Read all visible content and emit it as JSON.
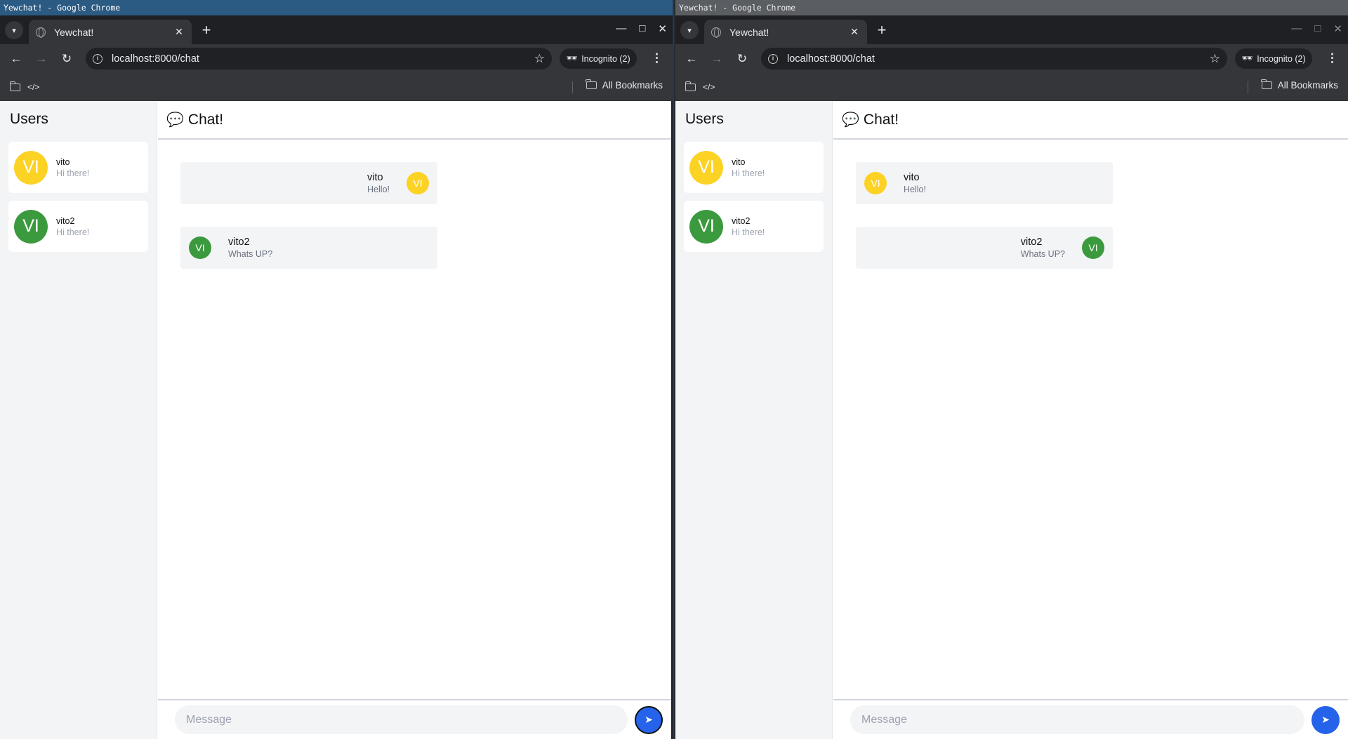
{
  "colors": {
    "yellow_avatar": "#fcd224",
    "green_avatar": "#3b9a3e",
    "send": "#2563eb"
  },
  "windows": [
    {
      "title": "Yewchat! - Google Chrome",
      "tab": {
        "title": "Yewchat!",
        "close": "✕"
      },
      "new_tab": "+",
      "url": "localhost:8000/chat",
      "incognito": "Incognito (2)",
      "bookmark_code": "</>",
      "all_bookmarks": "All Bookmarks",
      "app": {
        "sidebar_title": "Users",
        "users": [
          {
            "initials": "VI",
            "name": "vito",
            "last": "Hi there!",
            "color": "yellow"
          },
          {
            "initials": "VI",
            "name": "vito2",
            "last": "Hi there!",
            "color": "green"
          }
        ],
        "header": {
          "icon": "💬",
          "title": "Chat!"
        },
        "messages": [
          {
            "side": "right",
            "initials": "VI",
            "name": "vito",
            "text": "Hello!",
            "color": "yellow"
          },
          {
            "side": "left",
            "initials": "VI",
            "name": "vito2",
            "text": "Whats UP?",
            "color": "green"
          }
        ],
        "composer_placeholder": "Message"
      }
    },
    {
      "title": "Yewchat! - Google Chrome",
      "tab": {
        "title": "Yewchat!",
        "close": "✕"
      },
      "new_tab": "+",
      "url": "localhost:8000/chat",
      "incognito": "Incognito (2)",
      "bookmark_code": "</>",
      "all_bookmarks": "All Bookmarks",
      "app": {
        "sidebar_title": "Users",
        "users": [
          {
            "initials": "VI",
            "name": "vito",
            "last": "Hi there!",
            "color": "yellow"
          },
          {
            "initials": "VI",
            "name": "vito2",
            "last": "Hi there!",
            "color": "green"
          }
        ],
        "header": {
          "icon": "💬",
          "title": "Chat!"
        },
        "messages": [
          {
            "side": "left",
            "initials": "VI",
            "name": "vito",
            "text": "Hello!",
            "color": "yellow"
          },
          {
            "side": "right",
            "initials": "VI",
            "name": "vito2",
            "text": "Whats UP?",
            "color": "green"
          }
        ],
        "composer_placeholder": "Message"
      }
    }
  ]
}
